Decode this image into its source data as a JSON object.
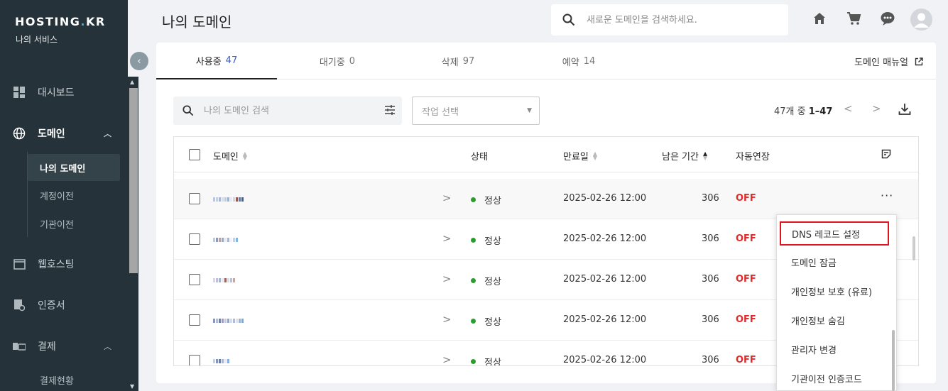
{
  "sidebar": {
    "logo_main": "HOSTING",
    "logo_dot": ".",
    "logo_tld": "KR",
    "subtitle": "나의 서비스",
    "items": [
      {
        "label": "대시보드",
        "icon": "dashboard-icon"
      },
      {
        "label": "도메인",
        "icon": "globe-icon"
      },
      {
        "label": "웹호스팅",
        "icon": "window-icon"
      },
      {
        "label": "인증서",
        "icon": "certificate-icon"
      },
      {
        "label": "결제",
        "icon": "payment-icon"
      }
    ],
    "domain_sub": [
      "나의 도메인",
      "계정이전",
      "기관이전"
    ],
    "payment_sub": [
      "결제현황"
    ]
  },
  "header": {
    "title": "나의 도메인",
    "search_placeholder": "새로운 도메인을 검색하세요."
  },
  "tabs": [
    {
      "label": "사용중",
      "count": "47"
    },
    {
      "label": "대기중",
      "count": "0"
    },
    {
      "label": "삭제",
      "count": "97"
    },
    {
      "label": "예약",
      "count": "14"
    }
  ],
  "manual_label": "도메인 매뉴얼",
  "toolbar": {
    "search_placeholder": "나의 도메인 검색",
    "select_placeholder": "작업 선택",
    "pager_prefix": "47개 중 ",
    "pager_range": "1–47"
  },
  "table": {
    "headers": {
      "domain": "도메인",
      "status": "상태",
      "expiry": "만료일",
      "remaining": "남은 기간",
      "autorenew": "자동연장"
    },
    "rows": [
      {
        "status": "정상",
        "expiry": "2025-02-26 12:00",
        "remaining": "306",
        "autorenew": "OFF"
      },
      {
        "status": "정상",
        "expiry": "2025-02-26 12:00",
        "remaining": "306",
        "autorenew": "OFF"
      },
      {
        "status": "정상",
        "expiry": "2025-02-26 12:00",
        "remaining": "306",
        "autorenew": "OFF"
      },
      {
        "status": "정상",
        "expiry": "2025-02-26 12:00",
        "remaining": "306",
        "autorenew": "OFF"
      },
      {
        "status": "정상",
        "expiry": "2025-02-26 12:00",
        "remaining": "306",
        "autorenew": "OFF"
      }
    ]
  },
  "menu": [
    "DNS 레코드 설정",
    "도메인 잠금",
    "개인정보 보호 (유료)",
    "개인정보 숨김",
    "관리자 변경",
    "기관이전 인증코드"
  ],
  "colors": {
    "sidebar_bg": "#253239",
    "accent_blue": "#3a62c9",
    "status_green": "#2a9d2a",
    "off_red": "#e12a2a",
    "highlight_border": "#e0141e"
  }
}
